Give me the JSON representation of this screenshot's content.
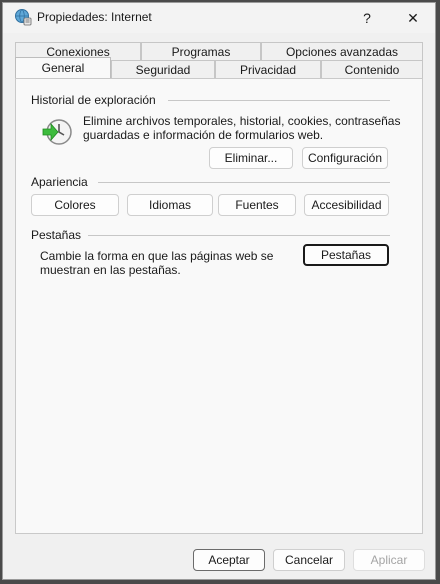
{
  "window": {
    "title": "Propiedades: Internet",
    "help_symbol": "?",
    "close_symbol": "✕"
  },
  "tabs": {
    "back_row": [
      "Conexiones",
      "Programas",
      "Opciones avanzadas"
    ],
    "front_row": [
      "General",
      "Seguridad",
      "Privacidad",
      "Contenido"
    ],
    "active": "General"
  },
  "history": {
    "label": "Historial de exploración",
    "desc_line1": "Elimine archivos temporales, historial, cookies, contraseñas",
    "desc_line2": "guardadas e información de formularios web.",
    "delete_label": "Eliminar...",
    "settings_label": "Configuración",
    "icon": "history-clock-icon"
  },
  "appearance": {
    "label": "Apariencia",
    "colors_label": "Colores",
    "languages_label": "Idiomas",
    "fonts_label": "Fuentes",
    "accessibility_label": "Accesibilidad"
  },
  "tabs_section": {
    "label": "Pestañas",
    "desc_line1": "Cambie la forma en que las páginas web se",
    "desc_line2": "muestran en las pestañas.",
    "button_label": "Pestañas"
  },
  "footer": {
    "accept_label": "Aceptar",
    "cancel_label": "Cancelar",
    "apply_label": "Aplicar"
  },
  "colors": {
    "backdrop": "#4a4a4a",
    "window_bg": "#f0f0f0",
    "panel_bg": "#f9f9f9"
  }
}
